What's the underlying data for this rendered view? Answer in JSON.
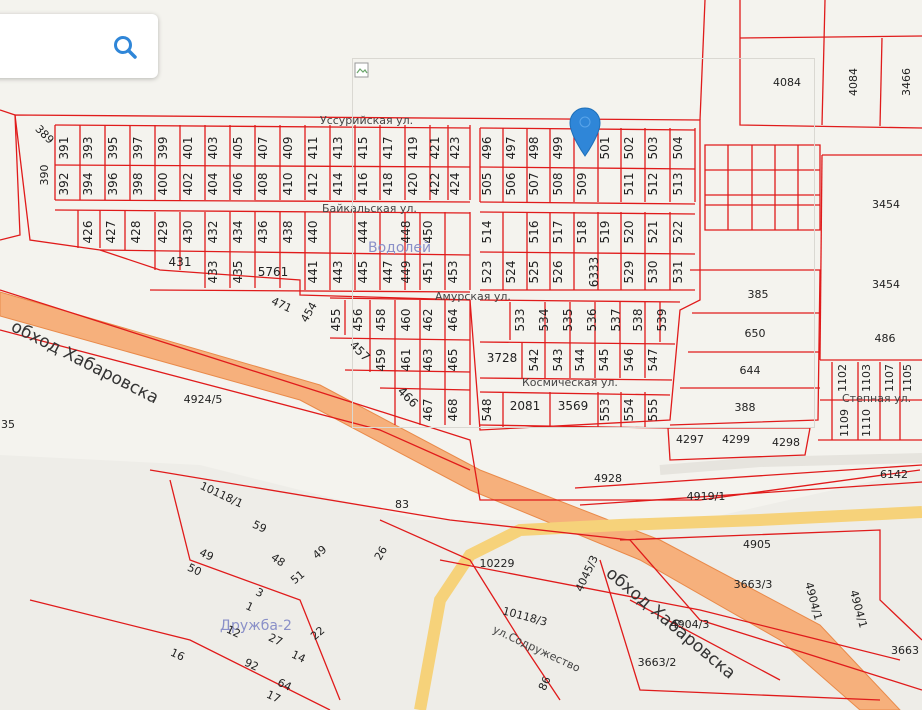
{
  "search": {
    "button_icon": "search-icon",
    "accent_color": "#2f86d8"
  },
  "marker": {
    "icon": "map-pin-icon",
    "color": "#2f86d8"
  },
  "colors": {
    "parcel_border": "#e01b1b",
    "road": "#f4a46a",
    "background": "#f4f3ee"
  },
  "streets": {
    "ussuriyskaya": "Уссурийская ул.",
    "baykalskaya": "Байкальская ул.",
    "amurskaya": "Амурская ул.",
    "kosmicheskaya": "Космическая ул.",
    "stepnaya": "Степная ул.",
    "sodruzhestvo": "ул.Содружество"
  },
  "places": {
    "vodoley": "Водолей",
    "druzhba": "Дружба-2"
  },
  "highways": {
    "bypass_west": "обход Хабаровска",
    "bypass_east": "обход Хабаровска"
  },
  "parcels": {
    "row1_top": [
      "391",
      "393",
      "395",
      "397",
      "399",
      "401",
      "403",
      "405",
      "407",
      "409",
      "411",
      "413",
      "415",
      "417",
      "419",
      "421",
      "423",
      "496",
      "497",
      "498",
      "499",
      "501",
      "502",
      "503",
      "504"
    ],
    "row1_bottom": [
      "392",
      "394",
      "396",
      "398",
      "400",
      "402",
      "404",
      "406",
      "408",
      "410",
      "412",
      "414",
      "416",
      "418",
      "420",
      "422",
      "424",
      "505",
      "506",
      "507",
      "508",
      "509",
      "511",
      "512",
      "513"
    ],
    "row2": [
      "426",
      "427",
      "428",
      "429",
      "430",
      "432",
      "434",
      "436",
      "438",
      "440",
      "444",
      "448",
      "450",
      "514",
      "516",
      "517",
      "518",
      "519",
      "520",
      "521",
      "522"
    ],
    "row3": [
      "431",
      "433",
      "435",
      "5761",
      "441",
      "443",
      "445",
      "447",
      "449",
      "451",
      "453",
      "523",
      "524",
      "525",
      "526",
      "6333",
      "529",
      "530",
      "531"
    ],
    "row4": [
      "455",
      "456",
      "458",
      "460",
      "462",
      "464",
      "533",
      "534",
      "535",
      "536",
      "537",
      "538",
      "539"
    ],
    "row5": [
      "457",
      "459",
      "461",
      "463",
      "465",
      "3728",
      "542",
      "543",
      "544",
      "545",
      "546",
      "547"
    ],
    "row6": [
      "466",
      "467",
      "468",
      "548",
      "2081",
      "3569",
      "553",
      "554",
      "555"
    ],
    "misc": [
      "389",
      "390",
      "471",
      "454",
      "4084",
      "4084",
      "3466",
      "3454",
      "3454",
      "385",
      "650",
      "644",
      "388",
      "486",
      "4297",
      "4299",
      "4298",
      "1102",
      "1103",
      "1107",
      "1105",
      "1109",
      "1110",
      "4928",
      "4919/1",
      "6142",
      "4924/5",
      "35",
      "83",
      "10118/1",
      "59",
      "49",
      "50",
      "48",
      "49",
      "51",
      "26",
      "3",
      "1",
      "12",
      "27",
      "14",
      "22",
      "16",
      "92",
      "64",
      "17",
      "10229",
      "4045/3",
      "10118/3",
      "4904/3",
      "3663/2",
      "3663/3",
      "4905",
      "4904/1",
      "4904/1",
      "3663",
      "86"
    ]
  }
}
